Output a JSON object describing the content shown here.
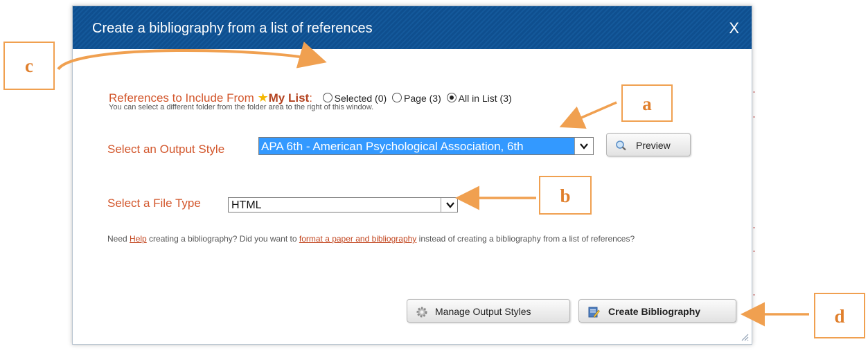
{
  "dialog": {
    "title": "Create a bibliography from a list of references",
    "close_label": "X",
    "references": {
      "label": "References to Include From",
      "list_name": "My List",
      "separator": ":",
      "options": [
        {
          "label": "Selected (0)",
          "checked": false
        },
        {
          "label": "Page (3)",
          "checked": false
        },
        {
          "label": "All in List (3)",
          "checked": true
        }
      ],
      "hint": "You can select a different folder from the folder area to the right of this window."
    },
    "output_style": {
      "label": "Select an Output Style",
      "selected": "APA 6th - American Psychological Association, 6th",
      "preview_button": "Preview"
    },
    "file_type": {
      "label": "Select a File Type",
      "selected": "HTML"
    },
    "help": {
      "prefix": "Need ",
      "help_link": "Help",
      "middle": " creating a bibliography? Did you want to ",
      "format_link": "format a paper and bibliography",
      "suffix": " instead of creating a bibliography from a list of references?"
    },
    "buttons": {
      "manage": "Manage Output Styles",
      "create": "Create Bibliography"
    }
  },
  "annotations": {
    "a": "a",
    "b": "b",
    "c": "c",
    "d": "d"
  },
  "colors": {
    "title_bar": "#0f4f8f",
    "label_orange": "#d2552a",
    "annotation": "#f0a050",
    "selection": "#3399ff"
  },
  "icons": [
    "star-icon",
    "magnifier-icon",
    "gear-icon",
    "notepad-pencil-icon",
    "chevron-down-icon",
    "resize-grip-icon"
  ]
}
